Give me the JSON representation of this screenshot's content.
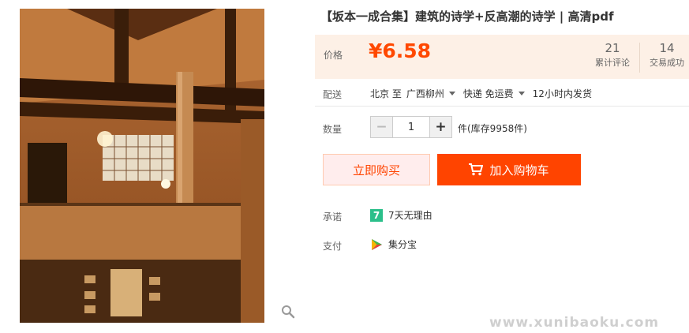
{
  "product": {
    "title": "【坂本一成合集】建筑的诗学+反高潮的诗学 | 高清pdf",
    "image_alt": "wooden interior photo"
  },
  "price": {
    "label": "价格",
    "value": "¥6.58",
    "reviews_count": "21",
    "reviews_label": "累计评论",
    "deals_count": "14",
    "deals_label": "交易成功"
  },
  "delivery": {
    "label": "配送",
    "from": "北京 至",
    "to": "广西柳州",
    "shipping": "快递 免运费",
    "dispatch": "12小时内发货"
  },
  "quantity": {
    "label": "数量",
    "value": "1",
    "stock": "件(库存9958件)"
  },
  "actions": {
    "buy_now": "立即购买",
    "add_to_cart": "加入购物车"
  },
  "promise": {
    "label": "承诺",
    "icon_char": "7",
    "text": "7天无理由"
  },
  "payment": {
    "label": "支付",
    "text": "集分宝"
  },
  "watermark": "www.xunibaoku.com",
  "colors": {
    "accent": "#ff4400",
    "price_bg": "#fdf0e6",
    "promise_green": "#2bbf8a"
  },
  "icons": [
    "zoom-icon",
    "caret-down-icon",
    "cart-icon",
    "seven-day-icon",
    "jifenbao-icon"
  ]
}
